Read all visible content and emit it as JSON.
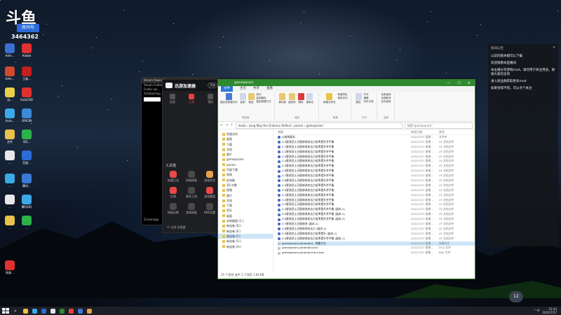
{
  "stream": {
    "logo": "斗鱼",
    "badge": "房间号",
    "room_id": "3464362"
  },
  "desktop_icons": [
    {
      "label": "Adm...",
      "color": "#3b6fd1"
    },
    {
      "label": "Adobe",
      "color": "#e03030"
    },
    {
      "label": "Adm...",
      "color": "#d24a2e"
    },
    {
      "label": "王者...",
      "color": "#c02020"
    },
    {
      "label": "迅...",
      "color": "#e8d04a"
    },
    {
      "label": "AutoCAD",
      "color": "#e03030"
    },
    {
      "label": "Auto...",
      "color": "#3baae6"
    },
    {
      "label": "ORICIN",
      "color": "#3a8ad6"
    },
    {
      "label": "文件",
      "color": "#e8c24a"
    },
    {
      "label": "QQ...",
      "color": "#2bb24a"
    },
    {
      "label": "...",
      "color": "#e8e8e8"
    },
    {
      "label": "百度...",
      "color": "#2a6bd8"
    },
    {
      "label": "...",
      "color": "#3baae6"
    },
    {
      "label": "腾讯...",
      "color": "#3a7ad6"
    },
    {
      "label": "...",
      "color": "#e8e8e8"
    },
    {
      "label": "腾讯QQ",
      "color": "#3baae6"
    },
    {
      "label": "...",
      "color": "#e8c24a"
    },
    {
      "label": "...",
      "color": "#2bb24a"
    },
    {
      "label": "网易...",
      "color": "#e03030"
    }
  ],
  "dark_window": {
    "title": "Steam Power Manager",
    "lines": [
      "Steam Folder - Proper...",
      "Folder wo...",
      "Autobackup..."
    ],
    "box_label": "Steam File",
    "bottom_label": "Screenage"
  },
  "app": {
    "title": "迅游加速器",
    "pill": "开始",
    "tabs": [
      {
        "label": "加速",
        "active": false
      },
      {
        "label": "工具",
        "active": true
      },
      {
        "label": "我的",
        "active": false
      }
    ],
    "tools_title": "工具箱",
    "tools": [
      {
        "label": "加速日志",
        "color": "#e84a4a"
      },
      {
        "label": "网络修复",
        "color": "#4a4a4a"
      },
      {
        "label": "游戏优化",
        "color": "#e8a04a"
      },
      {
        "label": "反馈",
        "color": "#e84a4a"
      },
      {
        "label": "更多工具",
        "color": "#4a4a4a"
      },
      {
        "label": "游戏截图",
        "color": "#e84a4a"
      },
      {
        "label": "网络诊断",
        "color": "#4a4a4a"
      },
      {
        "label": "游戏修复",
        "color": "#4a4a4a"
      },
      {
        "label": "DNS设置",
        "color": "#4a4a4a"
      }
    ],
    "footer": "© 迅游 加速器"
  },
  "explorer": {
    "title": "gameparam",
    "window_controls": [
      "—",
      "☐",
      "✕"
    ],
    "menu": [
      "文件",
      "主页",
      "共享",
      "查看"
    ],
    "ribbon_groups": [
      {
        "label": "剪贴板",
        "buttons": [
          {
            "label": "固定到快速访问",
            "color": "#4a7ad6"
          },
          {
            "label": "复制",
            "color": "#cfd9e8"
          },
          {
            "label": "粘贴",
            "color": "#e8c870"
          }
        ],
        "small": [
          "剪切",
          "复制路径",
          "粘贴快捷方式"
        ]
      },
      {
        "label": "组织",
        "buttons": [
          {
            "label": "移动到",
            "color": "#e8c870"
          },
          {
            "label": "复制到",
            "color": "#e8c870"
          },
          {
            "label": "删除",
            "color": "#d83b3b"
          },
          {
            "label": "重命名",
            "color": "#cfd9e8"
          }
        ],
        "small": []
      },
      {
        "label": "新建",
        "buttons": [
          {
            "label": "新建文件夹",
            "color": "#e8c24a"
          }
        ],
        "small": [
          "新建项目",
          "轻松访问"
        ]
      },
      {
        "label": "打开",
        "buttons": [
          {
            "label": "属性",
            "color": "#cfd9e8"
          }
        ],
        "small": [
          "打开",
          "编辑",
          "历史记录"
        ]
      },
      {
        "label": "选择",
        "buttons": [],
        "small": [
          "全部选择",
          "全部取消",
          "反向选择"
        ]
      }
    ],
    "path": "mods › Long May the Orolomu Reflect › param › gameparam",
    "search_placeholder": "搜索\"gameparam\"",
    "nav_items": [
      {
        "label": "快速访问",
        "selected": false
      },
      {
        "label": "桌面",
        "selected": false
      },
      {
        "label": "下载",
        "selected": false
      },
      {
        "label": "文档",
        "selected": false
      },
      {
        "label": "图片",
        "selected": false
      },
      {
        "label": "gameparam",
        "selected": false
      },
      {
        "label": "param",
        "selected": false
      },
      {
        "label": "百度下载",
        "selected": false
      },
      {
        "label": "视频",
        "selected": false
      },
      {
        "label": "此电脑",
        "selected": false
      },
      {
        "label": "3D 对象",
        "selected": false
      },
      {
        "label": "视频",
        "selected": false
      },
      {
        "label": "图片",
        "selected": false
      },
      {
        "label": "文档",
        "selected": false
      },
      {
        "label": "下载",
        "selected": false
      },
      {
        "label": "音乐",
        "selected": false
      },
      {
        "label": "桌面",
        "selected": false
      },
      {
        "label": "本地磁盘 (C:)",
        "selected": false
      },
      {
        "label": "新加卷 (D:)",
        "selected": false
      },
      {
        "label": "新加卷 (E:)",
        "selected": false
      },
      {
        "label": "新加卷 (F:)",
        "selected": true
      },
      {
        "label": "新加卷 (G:)",
        "selected": false
      },
      {
        "label": "新加卷 (H:)",
        "selected": false
      }
    ],
    "columns": [
      "名称",
      "修改日期",
      "类型"
    ],
    "files": [
      {
        "name": "以前的版本",
        "date": "2022/7/27 星期...",
        "type": "文件夹",
        "doc": false
      },
      {
        "name": "2.0更改武士天赋修改攻击力倍率提升并平衡",
        "date": "2022/7/27 星期...",
        "type": "XY 文档文件",
        "doc": false
      },
      {
        "name": "2.1更改武士天赋修改攻击力倍率提升并平衡",
        "date": "2022/7/27 星期...",
        "type": "XY 文档文件",
        "doc": false
      },
      {
        "name": "2.2更改武士天赋修改攻击力倍率提升并平衡",
        "date": "2022/7/27 星期...",
        "type": "XY 文档文件",
        "doc": false
      },
      {
        "name": "2.3更改武士天赋修改攻击力倍率提升并平衡",
        "date": "2022/7/27 星期...",
        "type": "XY 文档文件",
        "doc": false
      },
      {
        "name": "2.4更改武士天赋修改攻击力倍率提升并平衡",
        "date": "2022/7/27 星期...",
        "type": "XY 文档文件",
        "doc": false
      },
      {
        "name": "2.5更改武士天赋修改攻击力倍率提升并平衡",
        "date": "2022/7/27 星期...",
        "type": "XY 文档文件",
        "doc": false
      },
      {
        "name": "2.6更改武士天赋修改攻击力倍率提升并平衡",
        "date": "2022/7/27 星期...",
        "type": "XY 文档文件",
        "doc": false
      },
      {
        "name": "2.7更改武士天赋修改攻击力倍率提升并平衡",
        "date": "2022/7/27 星期...",
        "type": "XY 文档文件",
        "doc": false
      },
      {
        "name": "2.8更改武士天赋修改攻击力倍率提升并平衡",
        "date": "2022/7/27 星期...",
        "type": "XY 文档文件",
        "doc": false
      },
      {
        "name": "2.9更改武士天赋修改攻击力倍率提升并平衡",
        "date": "2022/7/27 星期...",
        "type": "XY 文档文件",
        "doc": false
      },
      {
        "name": "3.0更改武士天赋修改攻击力倍率提升并平衡",
        "date": "2022/7/27 星期...",
        "type": "XY 文档文件",
        "doc": false
      },
      {
        "name": "3.1更改武士天赋修改攻击力倍率提升并平衡",
        "date": "2022/7/27 星期...",
        "type": "XY 文档文件",
        "doc": false
      },
      {
        "name": "3.2更改武士天赋修改攻击力倍率提升并平衡",
        "date": "2022/7/27 星期...",
        "type": "XY 文档文件",
        "doc": false
      },
      {
        "name": "3.3更改武士天赋修改攻击力倍率提升并平衡",
        "date": "2022/7/27 星期...",
        "type": "XY 文档文件",
        "doc": false
      },
      {
        "name": "3.4更改武士天赋修改攻击力倍率提升并平衡 (副本-2)",
        "date": "2022/7/27 星期...",
        "type": "XY 文档文件",
        "doc": false
      },
      {
        "name": "3.5更改武士天赋修改攻击力倍率提升并平衡 (副本-2)",
        "date": "2022/7/27 星期...",
        "type": "XY 文档文件",
        "doc": false
      },
      {
        "name": "3.6更改武士天赋修改攻击力倍率提升并平衡 (副本-3)",
        "date": "2022/7/27 星期...",
        "type": "XY 文档文件",
        "doc": false
      },
      {
        "name": "3.7更改武士天赋修改 (副本-2)",
        "date": "2022/7/27 星期...",
        "type": "XY 文档文件",
        "doc": false
      },
      {
        "name": "3.8更改武士天赋修改攻击力 (副本-2)",
        "date": "2022/7/27 星期...",
        "type": "XY 文档文件",
        "doc": false
      },
      {
        "name": "3.9更改武士天赋修改攻击力倍率提升 (副本-1)",
        "date": "2022/7/27 星期...",
        "type": "XY 文档文件",
        "doc": false
      },
      {
        "name": "4.0更改武士天赋修改攻击力倍率提升并平衡 (副本-1)",
        "date": "2022/7/27 星期...",
        "type": "XY 文档文件",
        "doc": false
      },
      {
        "name": "gameparam.parambnd - 快捷方式",
        "date": "2022/7/27 星期...",
        "type": "快捷方式",
        "doc": true
      },
      {
        "name": "gameparam.parambnd.dcx",
        "date": "2022/7/27 星期...",
        "type": "DCX 文件",
        "doc": true
      },
      {
        "name": "gameparam.parambnd.dcx.bak",
        "date": "2022/7/27 星期...",
        "type": "BAK 文件",
        "doc": true
      }
    ],
    "selected_row": 22,
    "status": "25 个项目   选中 1 个项目  1.64 KB"
  },
  "chat": {
    "title": "房间公告",
    "close": "✕",
    "messages": [
      {
        "user": "",
        "text": "以前的版本都可以下载"
      },
      {
        "user": "",
        "text": "欢迎观看本直播间"
      },
      {
        "user": "",
        "text": "本主播分享游戏mod，请勿用于商业用途，谢谢大家的支持"
      },
      {
        "user": "",
        "text": "进入粉丝群获取更多mod"
      },
      {
        "user": "",
        "text": "如果觉得不错，可以点个关注"
      }
    ]
  },
  "taskbar": {
    "apps": [
      "#e8c24a",
      "#3baae6",
      "#2a6bd8",
      "#e8e8e8",
      "#2f8a2f",
      "#e84040",
      "#3a7ad6",
      "#e8a04a"
    ],
    "tray": "^ 中",
    "time": "21:43",
    "date": "2022/7/27"
  },
  "bubble": "12"
}
